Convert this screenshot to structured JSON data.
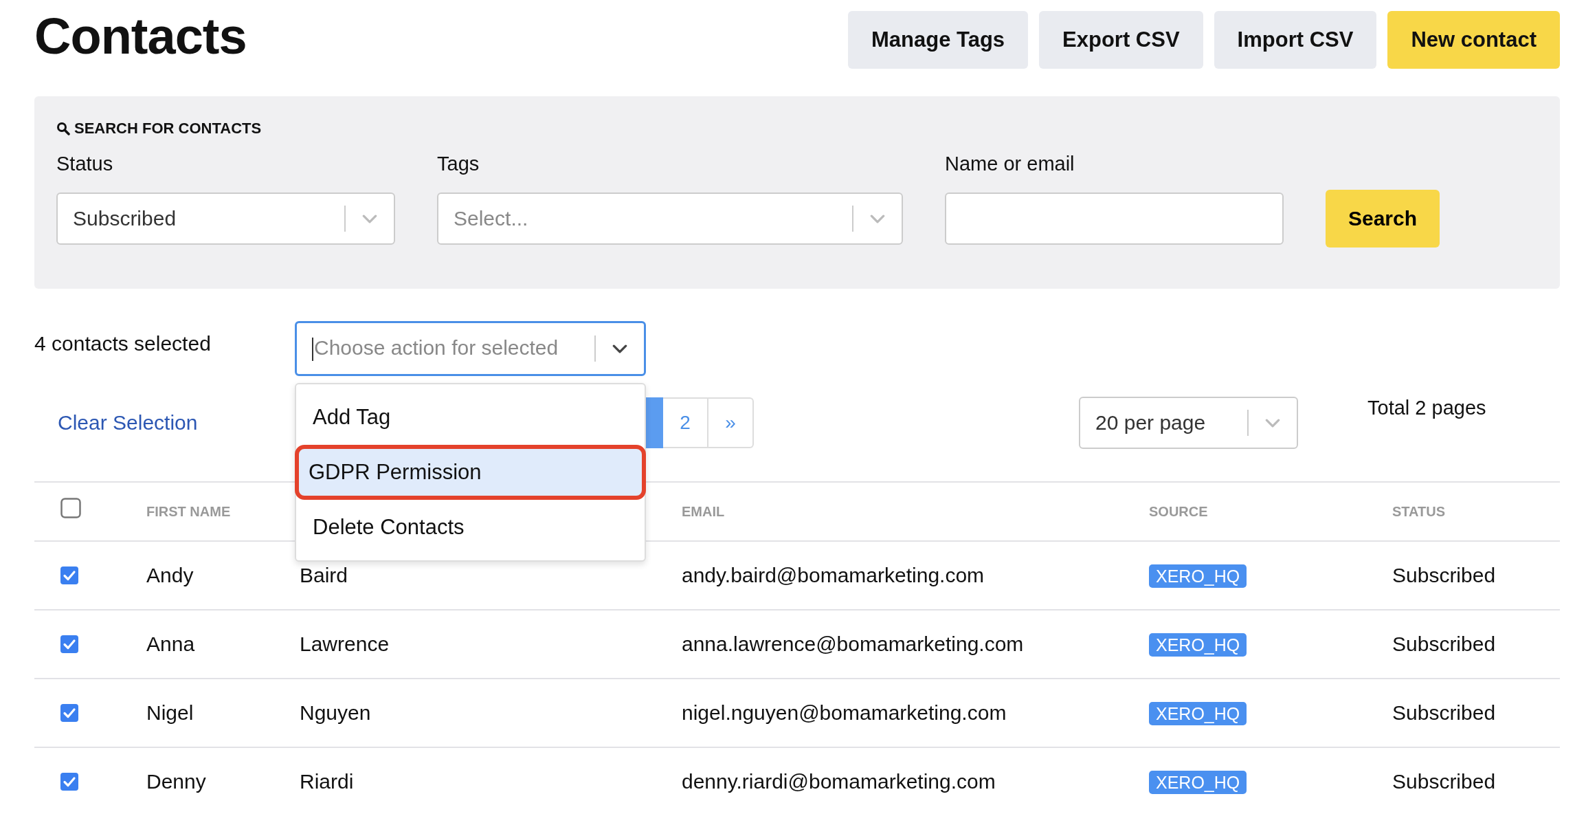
{
  "page": {
    "title": "Contacts"
  },
  "header_buttons": [
    {
      "label": "Manage Tags",
      "kind": "secondary"
    },
    {
      "label": "Export CSV",
      "kind": "secondary"
    },
    {
      "label": "Import CSV",
      "kind": "secondary"
    },
    {
      "label": "New contact",
      "kind": "primary"
    }
  ],
  "search": {
    "heading": "SEARCH FOR CONTACTS",
    "status": {
      "label": "Status",
      "value": "Subscribed"
    },
    "tags": {
      "label": "Tags",
      "placeholder": "Select..."
    },
    "name_or_email": {
      "label": "Name or email"
    },
    "button": "Search"
  },
  "selection": {
    "count_text": "4 contacts selected",
    "clear_link": "Clear Selection",
    "action_select": {
      "placeholder": "Choose action for selected",
      "focused": true,
      "open": true,
      "options": [
        {
          "label": "Add Tag",
          "highlighted": false
        },
        {
          "label": "GDPR Permission",
          "highlighted": true
        },
        {
          "label": "Delete Contacts",
          "highlighted": false
        }
      ]
    }
  },
  "pagination": {
    "pages": [
      {
        "label": "2",
        "selected": false
      }
    ],
    "next": "»",
    "per_page": "20 per page",
    "total": "Total 2 pages"
  },
  "table": {
    "select_all": {
      "checked": false
    },
    "columns": [
      "FIRST NAME",
      "EMAIL",
      "SOURCE",
      "STATUS"
    ],
    "rows": [
      {
        "checked": true,
        "first_name": "Andy",
        "last_name": "Baird",
        "email": "andy.baird@bomamarketing.com",
        "source": "XERO_HQ",
        "status": "Subscribed"
      },
      {
        "checked": true,
        "first_name": "Anna",
        "last_name": "Lawrence",
        "email": "anna.lawrence@bomamarketing.com",
        "source": "XERO_HQ",
        "status": "Subscribed"
      },
      {
        "checked": true,
        "first_name": "Nigel",
        "last_name": "Nguyen",
        "email": "nigel.nguyen@bomamarketing.com",
        "source": "XERO_HQ",
        "status": "Subscribed"
      },
      {
        "checked": true,
        "first_name": "Denny",
        "last_name": "Riardi",
        "email": "denny.riardi@bomamarketing.com",
        "source": "XERO_HQ",
        "status": "Subscribed"
      }
    ]
  }
}
